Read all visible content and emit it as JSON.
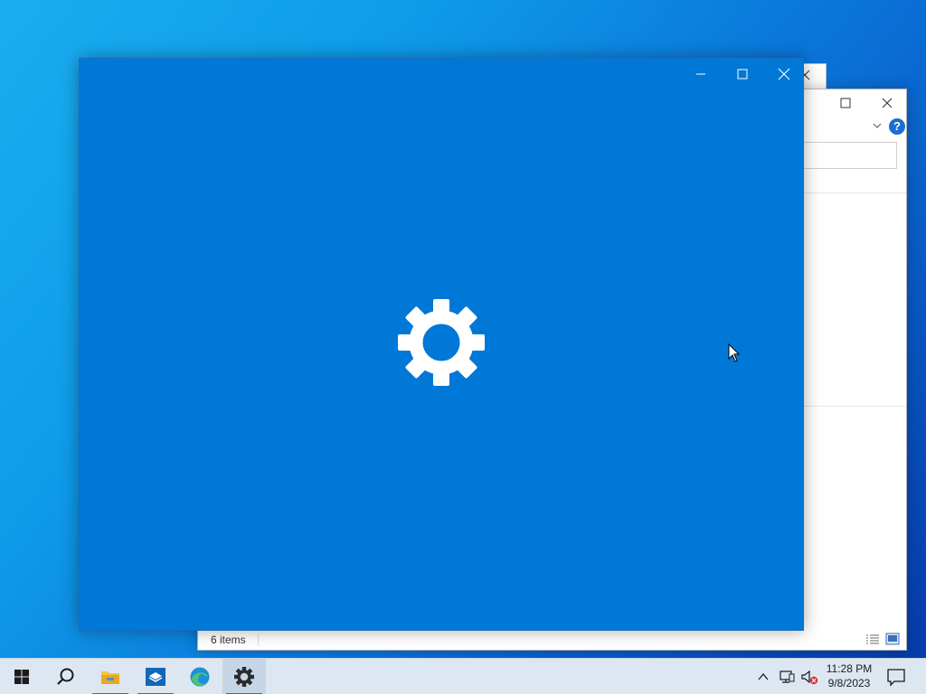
{
  "explorer_window": {
    "status_text": "6 items",
    "help_label": "?"
  },
  "taskbar": {
    "apps": [
      {
        "name": "File Explorer",
        "icon": "folder-icon",
        "running": true
      },
      {
        "name": "Server Manager",
        "icon": "server-manager-icon",
        "running": true
      },
      {
        "name": "Microsoft Edge",
        "icon": "edge-icon",
        "running": false
      },
      {
        "name": "Settings",
        "icon": "gear-icon",
        "running": true,
        "active": true
      }
    ],
    "clock": {
      "time": "11:28 PM",
      "date": "9/8/2023"
    }
  },
  "colors": {
    "settings_background": "#0078d7",
    "taskbar_background": "#dde7f2",
    "accent": "#1f73c9"
  }
}
